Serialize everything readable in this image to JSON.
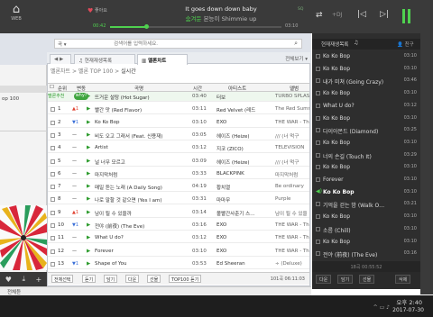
{
  "top": {
    "web_label": "WEB",
    "like_count": "좋아요",
    "song_line1": "It goes down down baby",
    "song_line2_highlight": "숨겨둔",
    "song_line2_rest": " 본능이 Shimmie up",
    "sq": "SQ",
    "time_current": "00:42",
    "time_total": "03:10",
    "progress_fraction": 0.22,
    "shuffle_label": "+DJ",
    "accent_color": "#4fd14f"
  },
  "search": {
    "scope": "곡",
    "placeholder": "검색어를 입력하세요."
  },
  "tabs": {
    "nav": "◀ ▶",
    "current": "현재재생목록",
    "melon": "멜론차트",
    "full_view": "전체보기"
  },
  "breadcrumb": {
    "path": "멜론차트 > 멜론 TOP 100 > ",
    "current": "실시간"
  },
  "left": {
    "item": "op 100"
  },
  "table": {
    "headers": [
      "순위",
      "변동",
      "곡명",
      "시간",
      "아티스트",
      "앨범"
    ],
    "melon_tag": "멜론추천",
    "why_tag": "why?",
    "rows": [
      {
        "rank": "",
        "change": "",
        "title": "뜨거운 설탕 (Hot Sugar)",
        "time": "03:40",
        "artist": "터보",
        "album": "TURBO SPLASH",
        "change_dir": ""
      },
      {
        "rank": "1",
        "change": "▲1",
        "title": "빨간 맛 (Red Flavor)",
        "time": "03:11",
        "artist": "Red Velvet (레드",
        "album": "The Red Summ",
        "change_dir": "up"
      },
      {
        "rank": "2",
        "change": "▼1",
        "title": "Ko Ko Bop",
        "time": "03:10",
        "artist": "EXO",
        "album": "THE WAR - The",
        "change_dir": "down"
      },
      {
        "rank": "3",
        "change": "—",
        "title": "비도 오고 그래서 (Feat. 신용재)",
        "time": "03:05",
        "artist": "헤이즈 (Heize)",
        "album": "/// (너 먹구",
        "change_dir": ""
      },
      {
        "rank": "4",
        "change": "—",
        "title": "Artist",
        "time": "03:12",
        "artist": "지코 (ZICO)",
        "album": "TELEVISION",
        "change_dir": ""
      },
      {
        "rank": "5",
        "change": "—",
        "title": "널 너무 모르고",
        "time": "03:09",
        "artist": "헤이즈 (Heize)",
        "album": "/// (너 먹구",
        "change_dir": ""
      },
      {
        "rank": "6",
        "change": "—",
        "title": "마지막처럼",
        "time": "03:33",
        "artist": "BLACKPINK",
        "album": "마지막처럼",
        "change_dir": ""
      },
      {
        "rank": "7",
        "change": "—",
        "title": "매일 듣는 노래 (A Daily Song)",
        "time": "04:19",
        "artist": "황치열",
        "album": "Be ordinary",
        "change_dir": ""
      },
      {
        "rank": "8",
        "change": "—",
        "title": "나로 말할 것 같으면 (Yes I am)",
        "time": "03:31",
        "artist": "마마무",
        "album": "Purple",
        "change_dir": ""
      },
      {
        "rank": "9",
        "change": "▲1",
        "title": "남이 될 수 있을까",
        "time": "03:14",
        "artist": "볼빨간사춘기 스…",
        "album": "남이 될 수 있을",
        "change_dir": "up"
      },
      {
        "rank": "10",
        "change": "▼1",
        "title": "전야 (前夜) (The Eve)",
        "time": "03:16",
        "artist": "EXO",
        "album": "THE WAR - The",
        "change_dir": "down"
      },
      {
        "rank": "11",
        "change": "—",
        "title": "What U do?",
        "time": "03:12",
        "artist": "EXO",
        "album": "THE WAR - The",
        "change_dir": ""
      },
      {
        "rank": "12",
        "change": "—",
        "title": "Forever",
        "time": "03:10",
        "artist": "EXO",
        "album": "THE WAR - The",
        "change_dir": ""
      },
      {
        "rank": "13",
        "change": "▼1",
        "title": "Shape of You",
        "time": "03:53",
        "artist": "Ed Sheeran",
        "album": "÷ (Deluxe)",
        "change_dir": "down"
      }
    ]
  },
  "bottom_buttons": [
    "전체선택",
    "듣기",
    "담기",
    "다운",
    "선물",
    "TOP100 듣기"
  ],
  "track_count": "101곡 06:11:03",
  "playlist": {
    "tab1": "현재재생목록",
    "tab2": "♫",
    "tab3": "친구",
    "items": [
      {
        "title": "Ko Ko Bop",
        "time": "03:10"
      },
      {
        "title": "Ko Ko Bop",
        "time": "03:10"
      },
      {
        "title": "내가 미쳐 (Going Crazy)",
        "time": "03:46"
      },
      {
        "title": "Ko Ko Bop",
        "time": "03:10"
      },
      {
        "title": "What U do?",
        "time": "03:12"
      },
      {
        "title": "Ko Ko Bop",
        "time": "03:10"
      },
      {
        "title": "다이아몬드 (Diamond)",
        "time": "03:25"
      },
      {
        "title": "Ko Ko Bop",
        "time": "03:10"
      },
      {
        "title": "너의 손길 (Touch It)",
        "time": "03:29"
      },
      {
        "title": "Ko Ko Bop",
        "time": "03:10"
      },
      {
        "title": "Forever",
        "time": "03:10"
      },
      {
        "title": "Ko Ko Bop",
        "time": "03:10"
      },
      {
        "title": "기억을 걷는 밤 (Walk O…",
        "time": "03:21"
      },
      {
        "title": "Ko Ko Bop",
        "time": "03:10"
      },
      {
        "title": "소름 (Chill)",
        "time": "03:10"
      },
      {
        "title": "Ko Ko Bop",
        "time": "03:10"
      },
      {
        "title": "전야 (前夜) (The Eve)",
        "time": "03:16"
      }
    ],
    "now_playing_index": 11,
    "sel_count": "18곡 00:55:52",
    "buttons": [
      "다운",
      "담기",
      "선물",
      "삭제"
    ]
  },
  "statusbar": "전체듣",
  "taskbar": {
    "time": "오후 2:40",
    "date": "2017-07-30",
    "icons": "^ ▭ ♪"
  }
}
